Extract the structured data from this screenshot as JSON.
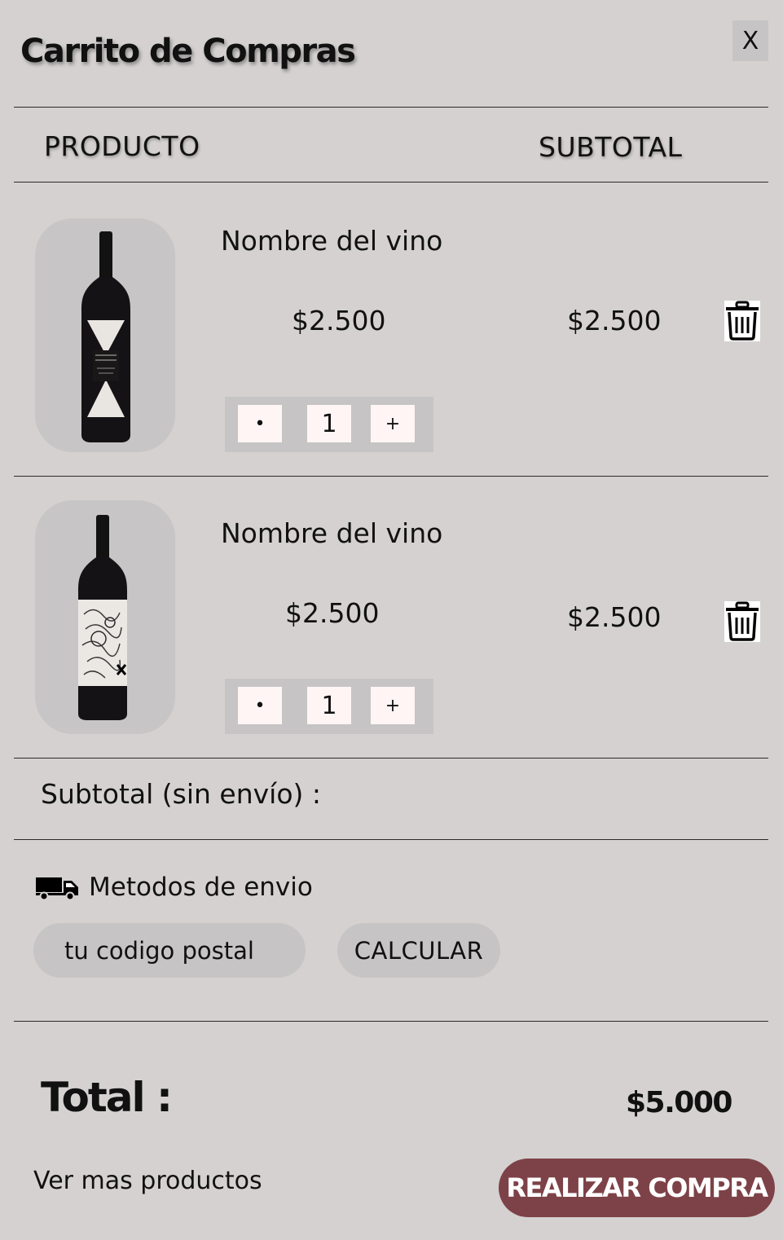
{
  "cart": {
    "title": "Carrito de Compras",
    "close_label": "X",
    "columns": {
      "product": "PRODUCTO",
      "subtotal": "SUBTOTAL"
    },
    "items": [
      {
        "name": "Nombre del vino",
        "unit_price": "$2.500",
        "subtotal": "$2.500",
        "quantity": "1",
        "decrement_label": "•",
        "increment_label": "+",
        "image": "wine-bottle-dark-label"
      },
      {
        "name": "Nombre del vino",
        "unit_price": "$2.500",
        "subtotal": "$2.500",
        "quantity": "1",
        "decrement_label": "•",
        "increment_label": "+",
        "image": "wine-bottle-white-label"
      }
    ],
    "subtotal_label": "Subtotal (sin envío) :",
    "shipping": {
      "label": "Metodos de envio",
      "icon": "truck-icon",
      "postal_placeholder": "tu codigo postal",
      "calculate_label": "CALCULAR"
    },
    "total_label": "Total :",
    "total_value": "$5.000",
    "more_products_label": "Ver mas productos",
    "checkout_label": "REALIZAR COMPRA",
    "colors": {
      "background": "#d5d1d1",
      "checkout": "#7d4247",
      "pill": "#c6c4c4"
    }
  }
}
